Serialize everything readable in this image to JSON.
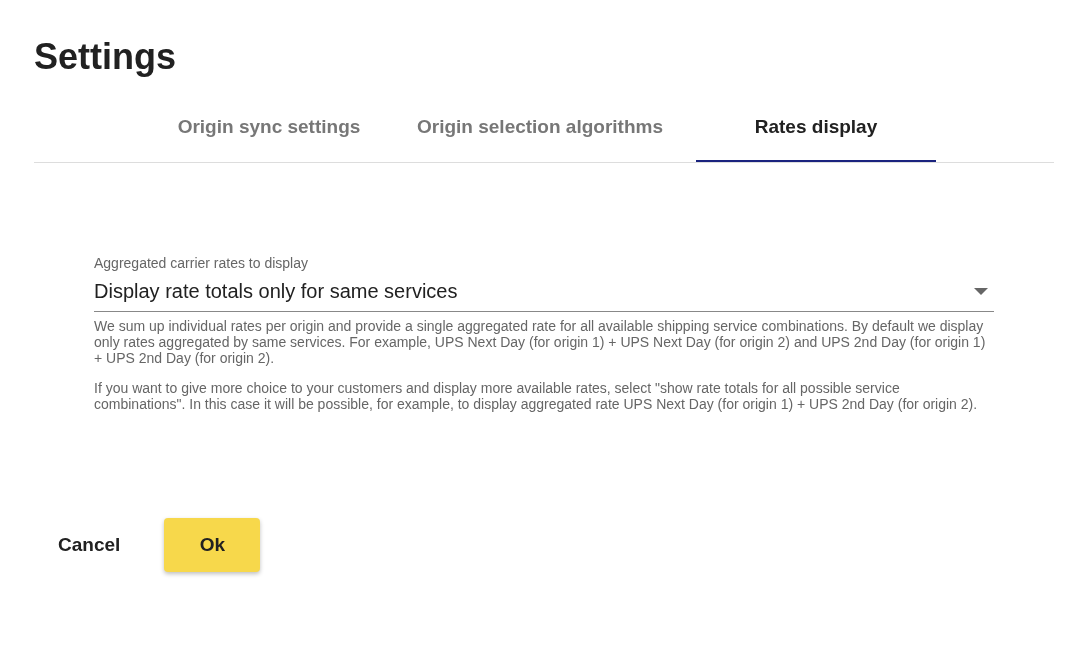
{
  "title": "Settings",
  "tabs": [
    {
      "label": "Origin sync settings",
      "selected": false
    },
    {
      "label": "Origin selection algorithms",
      "selected": false
    },
    {
      "label": "Rates display",
      "selected": true
    }
  ],
  "select": {
    "label": "Aggregated carrier rates to display",
    "value": "Display rate totals only for same services"
  },
  "help": [
    "We sum up individual rates per origin and provide a single aggregated rate for all available shipping service combinations. By default we display only rates aggregated by same services. For example, UPS Next Day (for origin 1) + UPS Next Day (for origin 2) and UPS 2nd Day (for origin 1) + UPS 2nd Day (for origin 2).",
    "If you want to give more choice to your customers and display more available rates, select \"show rate totals for all possible service combinations\". In this case it will be possible, for example, to display aggregated rate UPS Next Day (for origin 1) + UPS 2nd Day (for origin 2)."
  ],
  "buttons": [
    {
      "label": "Cancel",
      "kind": "text"
    },
    {
      "label": "Ok",
      "kind": "primary"
    }
  ]
}
